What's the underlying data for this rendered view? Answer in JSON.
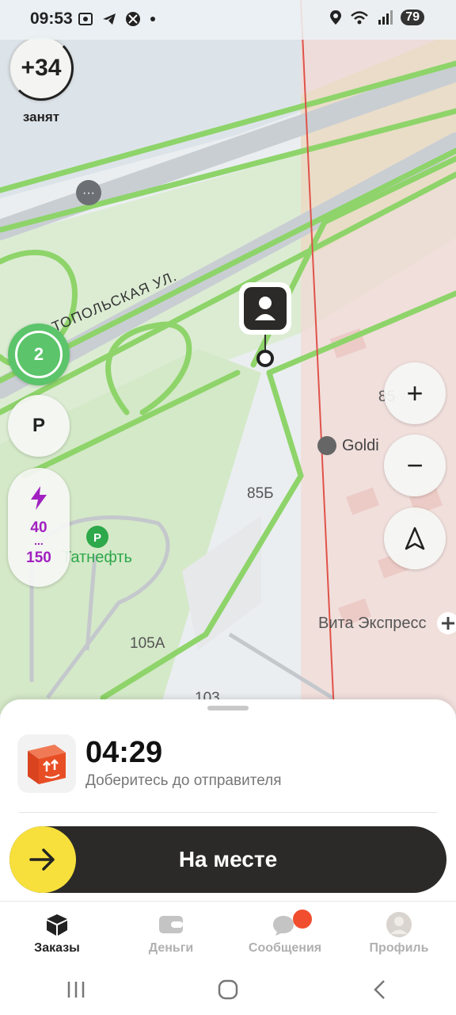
{
  "status_bar": {
    "time": "09:53",
    "battery": "79",
    "left_icons": [
      "screenshot-icon",
      "telegram-icon",
      "app-icon",
      "dot-icon"
    ],
    "right_icons": [
      "location-icon",
      "wifi-icon",
      "signal-icon",
      "battery-icon"
    ]
  },
  "driver": {
    "rating": "+34",
    "status": "занят"
  },
  "map": {
    "street_label": "ТОПОЛЬСКАЯ УЛ.",
    "poi_tatneft": "Татнефть",
    "poi_goldi": "Goldi",
    "poi_vita": "Вита Экспресс",
    "house_85b": "85Б",
    "house_85": "85",
    "house_105a": "105А",
    "house_103": "103"
  },
  "side_controls": {
    "queue_count": "2",
    "parking_label": "P",
    "tariff_top": "40",
    "tariff_dots": "...",
    "tariff_bottom": "150"
  },
  "zoom": {
    "zoom_in": "+",
    "zoom_out": "−"
  },
  "order": {
    "timer": "04:29",
    "subtitle": "Доберитесь до отправителя",
    "action_label": "На месте"
  },
  "tabs": [
    {
      "label": "Заказы",
      "icon": "box-icon",
      "active": true
    },
    {
      "label": "Деньги",
      "icon": "wallet-icon",
      "active": false
    },
    {
      "label": "Сообщения",
      "icon": "chat-icon",
      "active": false
    },
    {
      "label": "Профиль",
      "icon": "avatar-icon",
      "active": false
    }
  ],
  "colors": {
    "accent_yellow": "#f7e03c",
    "route_green": "#8ed46a",
    "tariff_purple": "#a020c0",
    "button_dark": "#2b2a28",
    "notification_red": "#f04e2e"
  }
}
